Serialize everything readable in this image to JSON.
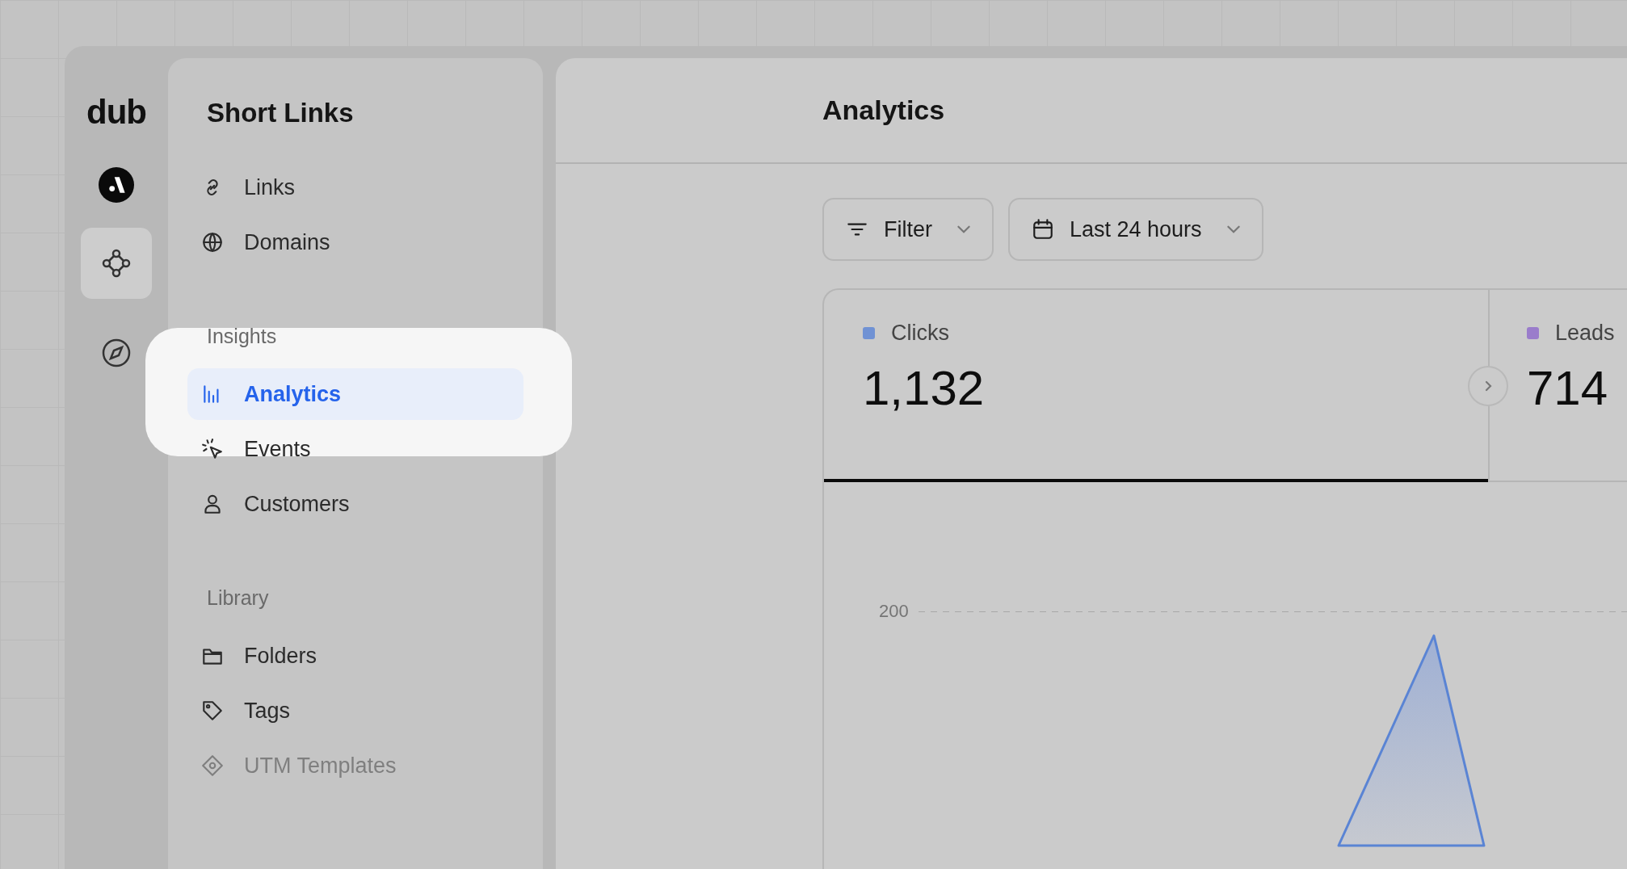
{
  "logo": {
    "text": "dub"
  },
  "rail": {
    "items": [
      {
        "kind": "avatar",
        "selected": false
      },
      {
        "kind": "nodes",
        "selected": true
      },
      {
        "kind": "compass",
        "selected": false
      }
    ]
  },
  "sidebar": {
    "title": "Short Links",
    "sections": [
      {
        "items": [
          {
            "label": "Links",
            "kind": "link",
            "selected": false,
            "faded": false
          },
          {
            "label": "Domains",
            "kind": "globe",
            "selected": false,
            "faded": false
          }
        ]
      },
      {
        "heading": "Insights",
        "highlighted": true,
        "items": [
          {
            "label": "Analytics",
            "kind": "bars",
            "selected": true,
            "faded": false
          },
          {
            "label": "Events",
            "kind": "click",
            "selected": false,
            "faded": false
          },
          {
            "label": "Customers",
            "kind": "person",
            "selected": false,
            "faded": false
          }
        ]
      },
      {
        "heading": "Library",
        "items": [
          {
            "label": "Folders",
            "kind": "folder",
            "selected": false,
            "faded": false
          },
          {
            "label": "Tags",
            "kind": "tag",
            "selected": false,
            "faded": false
          },
          {
            "label": "UTM Templates",
            "kind": "template",
            "selected": false,
            "faded": true
          }
        ]
      }
    ]
  },
  "main": {
    "title": "Analytics",
    "toolbar": [
      {
        "label": "Filter",
        "kind": "filter"
      },
      {
        "label": "Last 24 hours",
        "kind": "calendar"
      }
    ],
    "stats": [
      {
        "label": "Clicks",
        "value": "1,132",
        "color": "#7092d4",
        "selected": true
      },
      {
        "label": "Leads",
        "value": "714",
        "color": "#9a7ccb",
        "selected": false
      }
    ],
    "chart": {
      "y_tick": "200"
    }
  }
}
